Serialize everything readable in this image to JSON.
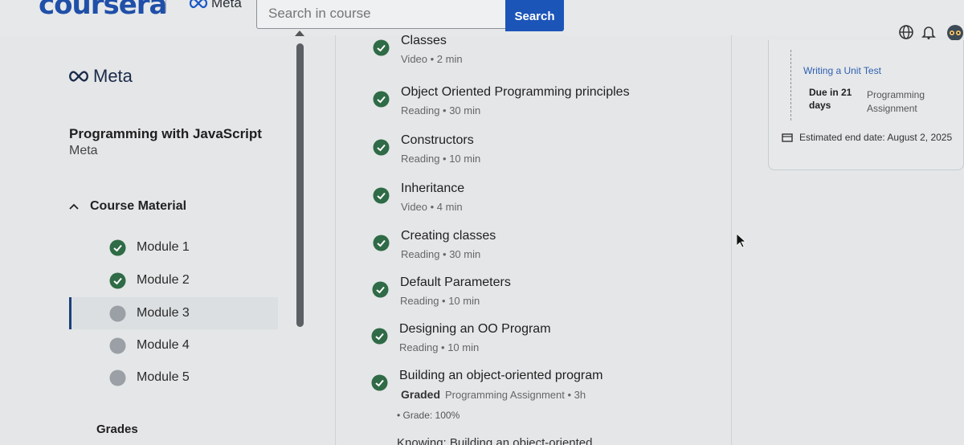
{
  "header": {
    "brand": "coursera",
    "partner_logo": "Meta",
    "search_placeholder": "Search in course",
    "search_button": "Search",
    "icons": [
      "globe-icon",
      "bell-icon",
      "avatar"
    ]
  },
  "sidebar": {
    "partner_logo": "Meta",
    "course_title": "Programming with JavaScript",
    "course_partner": "Meta",
    "section_label": "Course Material",
    "modules": [
      {
        "label": "Module 1",
        "status": "completed"
      },
      {
        "label": "Module 2",
        "status": "completed"
      },
      {
        "label": "Module 3",
        "status": "in-progress"
      },
      {
        "label": "Module 4",
        "status": "not-started"
      },
      {
        "label": "Module 5",
        "status": "not-started"
      }
    ],
    "grades_label": "Grades"
  },
  "items": [
    {
      "title": "Classes",
      "meta": "Video • 2 min"
    },
    {
      "title": "Object Oriented Programming principles",
      "meta": "Reading • 30 min"
    },
    {
      "title": "Constructors",
      "meta": "Reading • 10 min"
    },
    {
      "title": "Inheritance",
      "meta": "Video • 4 min"
    },
    {
      "title": "Creating classes",
      "meta": "Reading • 30 min"
    },
    {
      "title": "Default Parameters",
      "meta": "Reading • 10 min"
    },
    {
      "title": "Designing an OO Program",
      "meta": "Reading • 10 min"
    },
    {
      "title": "Building an object-oriented program",
      "graded_label": "Graded",
      "meta": "Programming Assignment • 3h"
    }
  ],
  "grade_line": "• Grade: 100%",
  "next_item_partial": "Knowing: Building an object-oriented",
  "deadline": {
    "link": "Writing a Unit Test",
    "due": "Due in 21 days",
    "type": "Programming Assignment",
    "end_date": "Estimated end date: August 2, 2025"
  },
  "colors": {
    "brand": "#1f4fa8",
    "accent": "#1c55b8",
    "check": "#2f6b46"
  }
}
